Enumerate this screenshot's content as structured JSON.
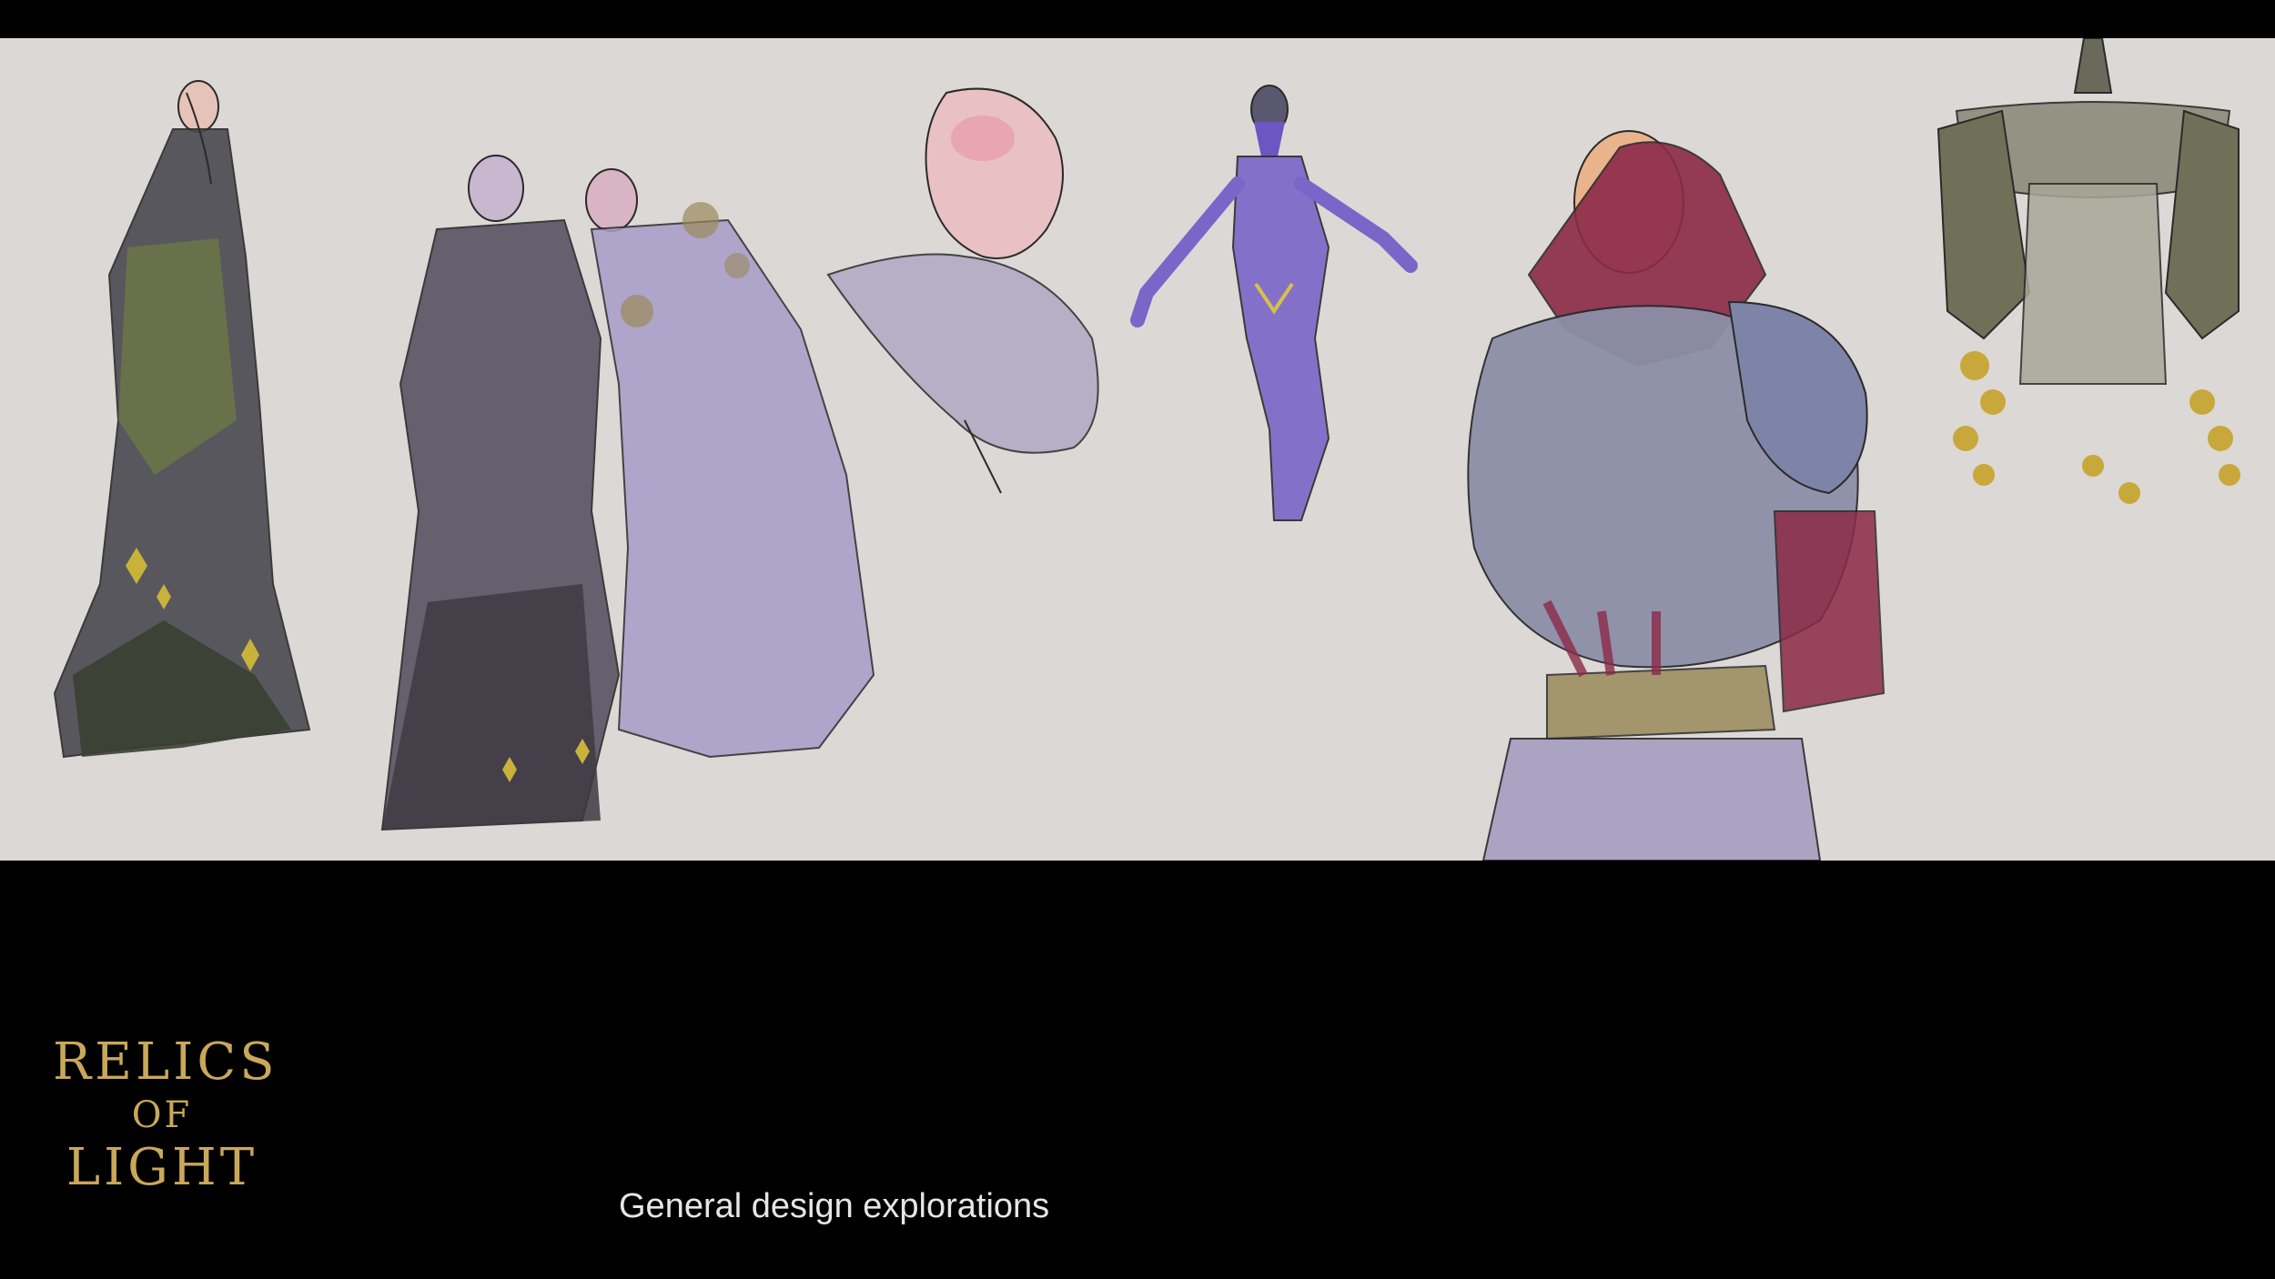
{
  "logo": {
    "line1": "RELICS",
    "line2": "OF",
    "line3": "LIGHT"
  },
  "caption": "General design explorations",
  "colors": {
    "background": "#000000",
    "paper": "#dcd8d5",
    "logo_gold": "#c9a85a",
    "caption_text": "#e6e6e6",
    "ink": "#2a2a2a",
    "lavender": "#a89cc8",
    "violet": "#7a66c8",
    "dark_robe": "#3c3a44",
    "moss": "#6f7a46",
    "crimson": "#8c2a48",
    "steel": "#8c8fa8",
    "gold_coin": "#c8a83a",
    "skin": "#e9b4a8"
  },
  "artwork": {
    "figures": [
      "robed-figure-icon",
      "embracing-couple-icon",
      "bald-head-bust-icon",
      "floating-masked-figure-icon",
      "armored-knight-icon",
      "hanging-relic-garment-icon"
    ]
  }
}
